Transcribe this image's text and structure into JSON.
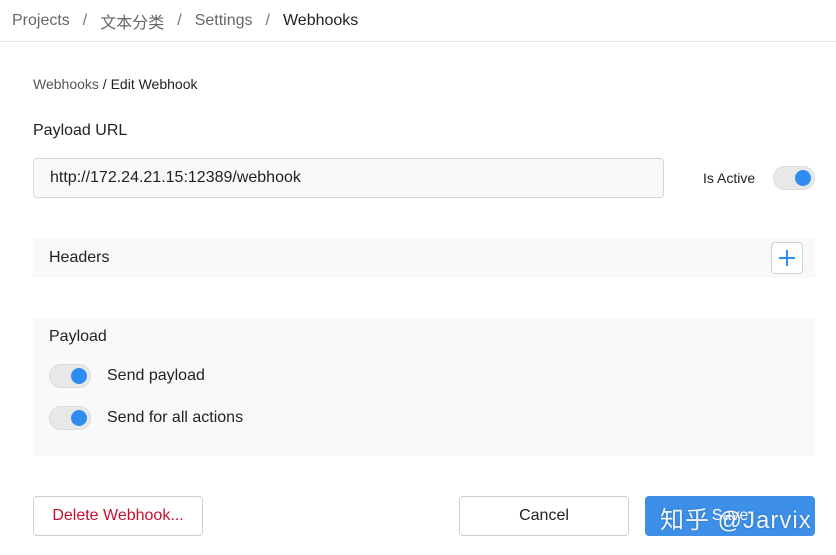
{
  "breadcrumb": {
    "items": [
      "Projects",
      "文本分类",
      "Settings",
      "Webhooks"
    ],
    "separator": "/"
  },
  "subcrumb": {
    "parent": "Webhooks",
    "separator": "/",
    "current": "Edit Webhook"
  },
  "payload_url": {
    "label": "Payload URL",
    "value": "http://172.24.21.15:12389/webhook"
  },
  "is_active": {
    "label": "Is Active",
    "on": true
  },
  "headers": {
    "title": "Headers",
    "add_icon": "plus-icon"
  },
  "payload": {
    "title": "Payload",
    "options": [
      {
        "label": "Send payload",
        "on": true
      },
      {
        "label": "Send for all actions",
        "on": true
      }
    ]
  },
  "buttons": {
    "delete": "Delete Webhook...",
    "cancel": "Cancel",
    "save": "Save"
  },
  "watermark": "知乎 @Jarvix",
  "colors": {
    "accent": "#2f8cf0",
    "danger": "#c8102e",
    "panel_bg": "#f9f9f9"
  }
}
